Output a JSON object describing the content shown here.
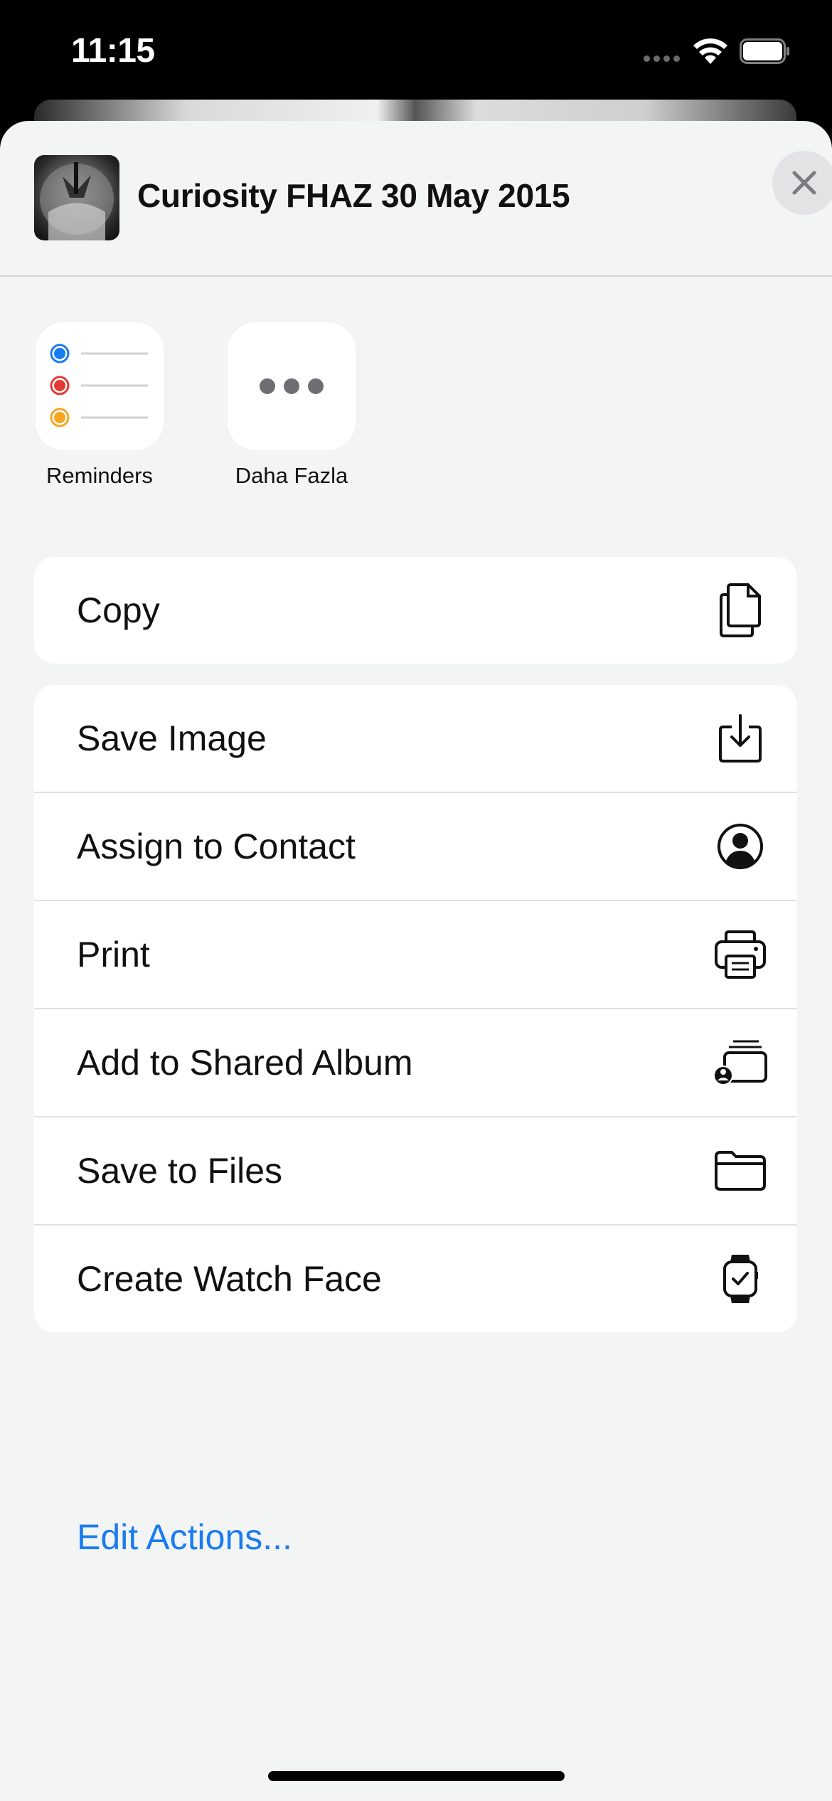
{
  "status_bar": {
    "time": "11:15"
  },
  "share_sheet": {
    "title": "Curiosity FHAZ 30 May 2015",
    "close_icon": "close-icon"
  },
  "apps": [
    {
      "label": "Reminders",
      "icon": "reminders-icon"
    },
    {
      "label": "Daha Fazla",
      "icon": "more-icon"
    }
  ],
  "actions_primary": [
    {
      "label": "Copy",
      "icon": "copy-icon"
    }
  ],
  "actions_secondary": [
    {
      "label": "Save Image",
      "icon": "save-image-icon"
    },
    {
      "label": "Assign to Contact",
      "icon": "person-circle-icon"
    },
    {
      "label": "Print",
      "icon": "printer-icon"
    },
    {
      "label": "Add to Shared Album",
      "icon": "shared-album-icon"
    },
    {
      "label": "Save to Files",
      "icon": "folder-icon"
    },
    {
      "label": "Create Watch Face",
      "icon": "watch-icon"
    }
  ],
  "edit_actions_label": "Edit Actions...",
  "colors": {
    "accent": "#1a7cf0",
    "sheet_background": "#f3f4f4",
    "reminder_blue": "#1a7cf0",
    "reminder_red": "#e53935",
    "reminder_orange": "#f5a623"
  }
}
